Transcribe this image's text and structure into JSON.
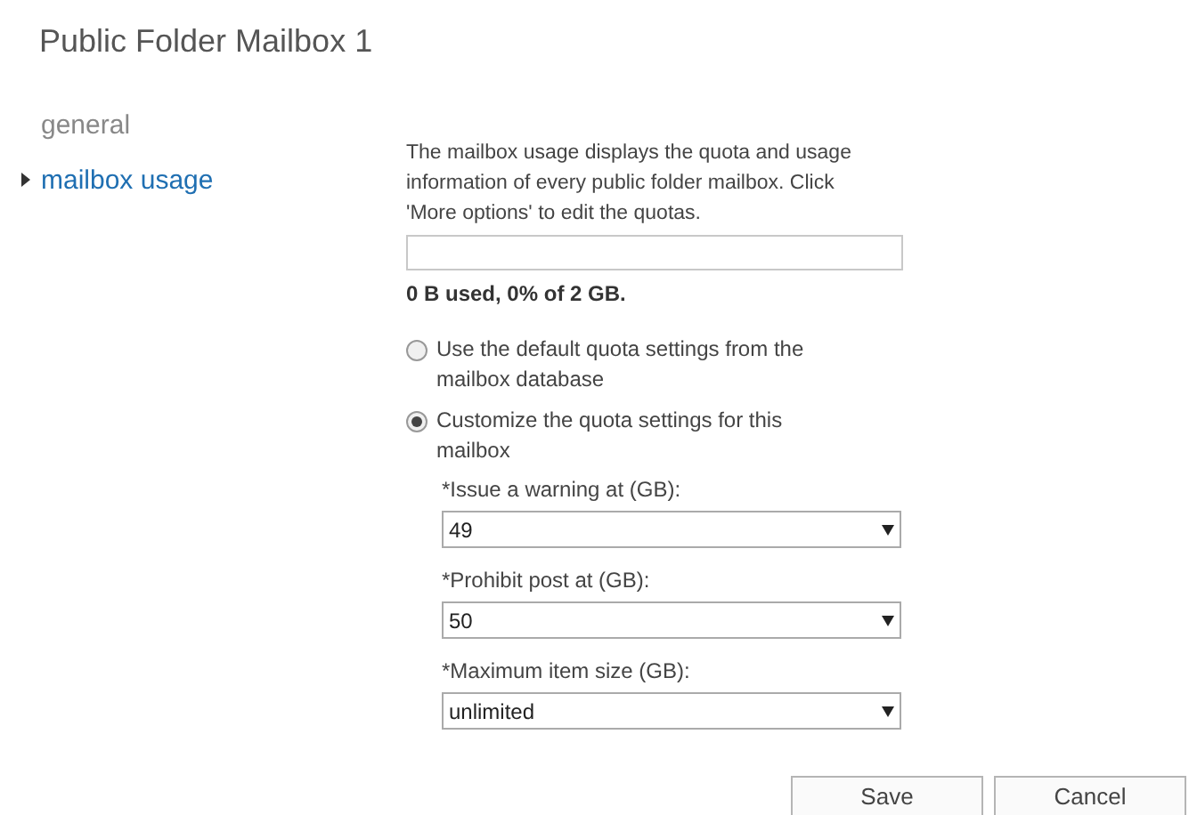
{
  "window": {
    "title": "Public Folder Mailbox 1"
  },
  "sidebar": {
    "items": [
      {
        "label": "general",
        "selected": false
      },
      {
        "label": "mailbox usage",
        "selected": true
      }
    ]
  },
  "usage": {
    "description": "The mailbox usage displays the quota and usage information of every public folder mailbox. Click 'More options' to edit the quotas.",
    "reading": "0 B used, 0% of 2 GB."
  },
  "quota_options": [
    {
      "label": "Use the default quota settings from the mailbox database",
      "selected": false
    },
    {
      "label": "Customize the quota settings for this mailbox",
      "selected": true
    }
  ],
  "fields": [
    {
      "label": "*Issue a warning at (GB):",
      "value": "49"
    },
    {
      "label": "*Prohibit post at (GB):",
      "value": "50"
    },
    {
      "label": "*Maximum item size (GB):",
      "value": "unlimited"
    }
  ],
  "buttons": [
    "Save",
    "Cancel"
  ]
}
